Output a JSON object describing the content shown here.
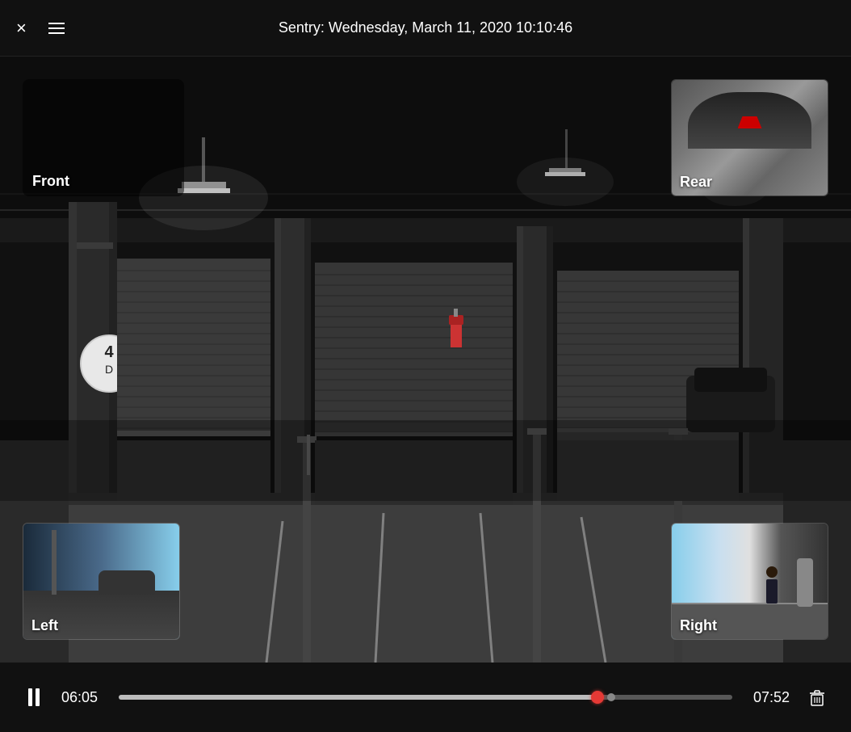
{
  "header": {
    "title": "Sentry: Wednesday, March 11, 2020 10:10:46",
    "close_label": "×",
    "menu_label": "menu"
  },
  "cameras": {
    "front": {
      "label": "Front",
      "position": "top-left"
    },
    "rear": {
      "label": "Rear",
      "position": "top-right"
    },
    "left": {
      "label": "Left",
      "position": "bottom-left"
    },
    "right": {
      "label": "Right",
      "position": "bottom-right"
    }
  },
  "controls": {
    "current_time": "06:05",
    "total_time": "07:52",
    "progress_percent": 78,
    "play_pause_state": "paused",
    "pause_label": "pause",
    "delete_label": "delete"
  },
  "colors": {
    "background": "#111111",
    "header_bg": "#111111",
    "progress_fill": "rgba(255,255,255,0.6)",
    "progress_handle": "#e53935",
    "text": "#ffffff"
  }
}
